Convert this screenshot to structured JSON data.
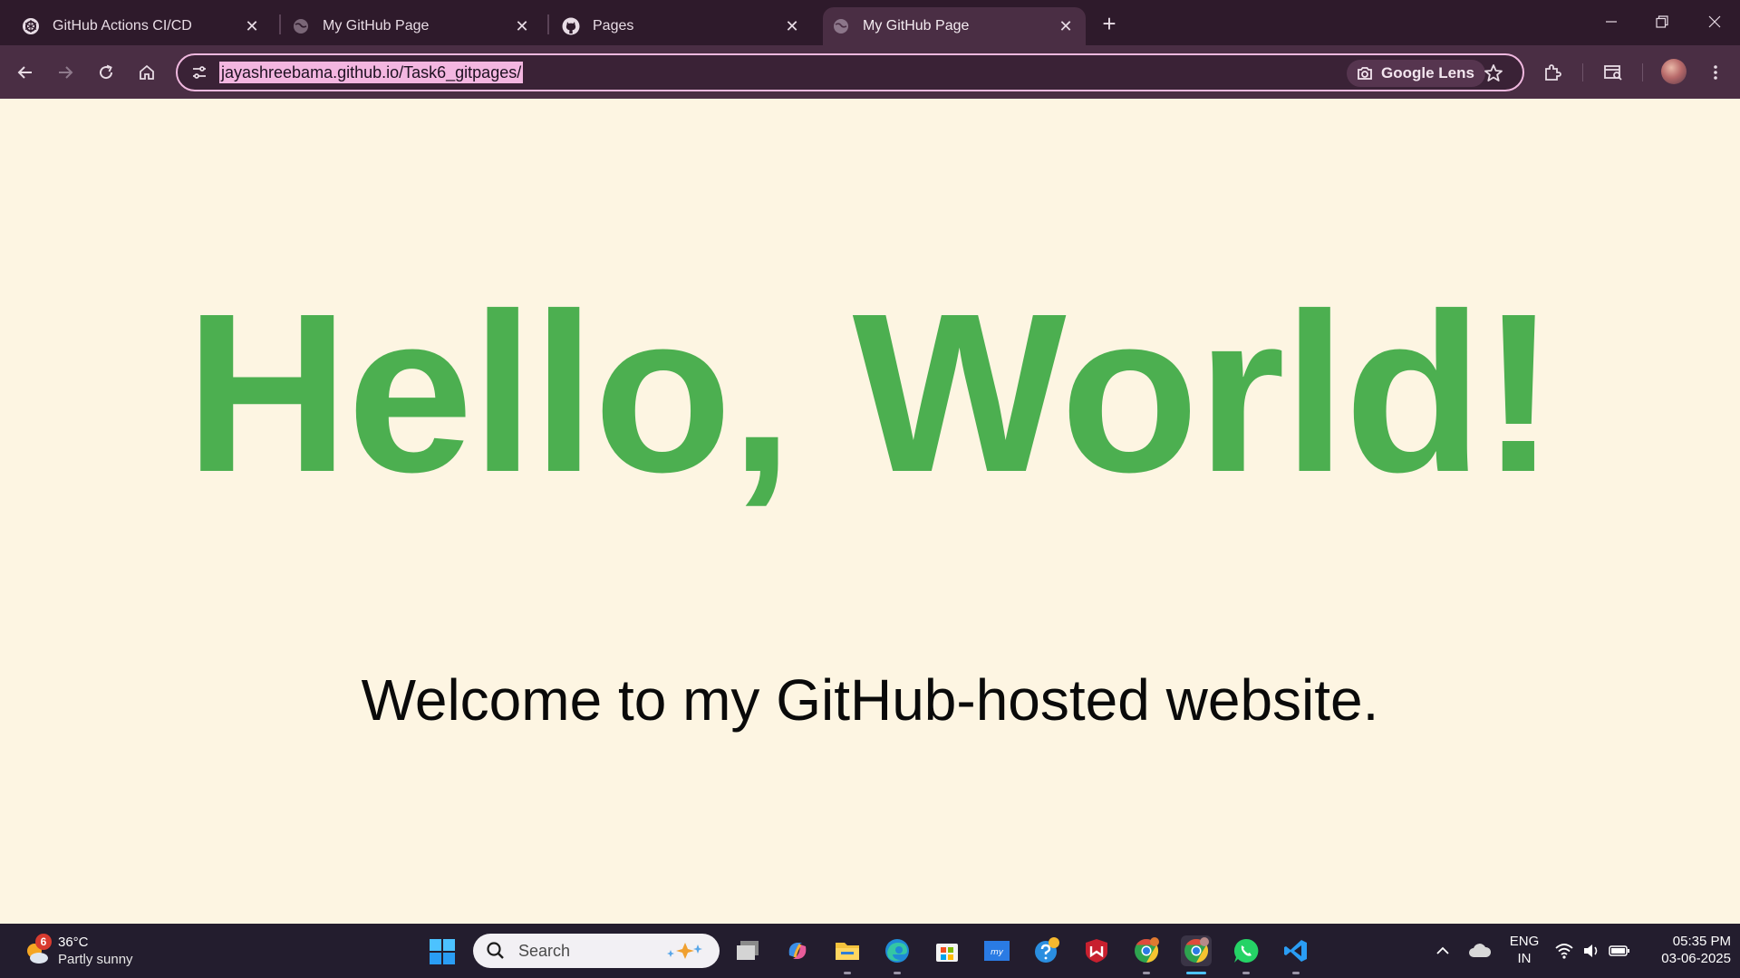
{
  "tabs": [
    {
      "title": "GitHub Actions CI/CD",
      "icon": "openai-icon",
      "active": false
    },
    {
      "title": "My GitHub Page",
      "icon": "globe-icon",
      "active": false
    },
    {
      "title": "Pages",
      "icon": "github-icon",
      "active": false
    },
    {
      "title": "My GitHub Page",
      "icon": "globe-icon",
      "active": true
    }
  ],
  "address_bar": {
    "url": "jayashreebama.github.io/Task6_gitpages/",
    "lens_label": "Google Lens"
  },
  "page": {
    "heading": "Hello, World!",
    "paragraph": "Welcome to my GitHub-hosted website."
  },
  "taskbar": {
    "weather": {
      "badge": "6",
      "temp": "36°C",
      "condition": "Partly sunny"
    },
    "search_placeholder": "Search",
    "language": {
      "line1": "ENG",
      "line2": "IN"
    },
    "clock": {
      "time": "05:35 PM",
      "date": "03-06-2025"
    },
    "apps": [
      "task-view",
      "copilot",
      "file-explorer",
      "edge",
      "microsoft-store",
      "mcafee-mypc",
      "get-help",
      "mcafee",
      "chrome-profile",
      "chrome-active",
      "whatsapp",
      "vscode"
    ]
  },
  "colors": {
    "heading": "#4caf50",
    "page_background": "#fdf5e2",
    "tabstrip": "#2e1a2b",
    "toolbar": "#4a2e44",
    "url_highlight": "#f3b6e0"
  }
}
